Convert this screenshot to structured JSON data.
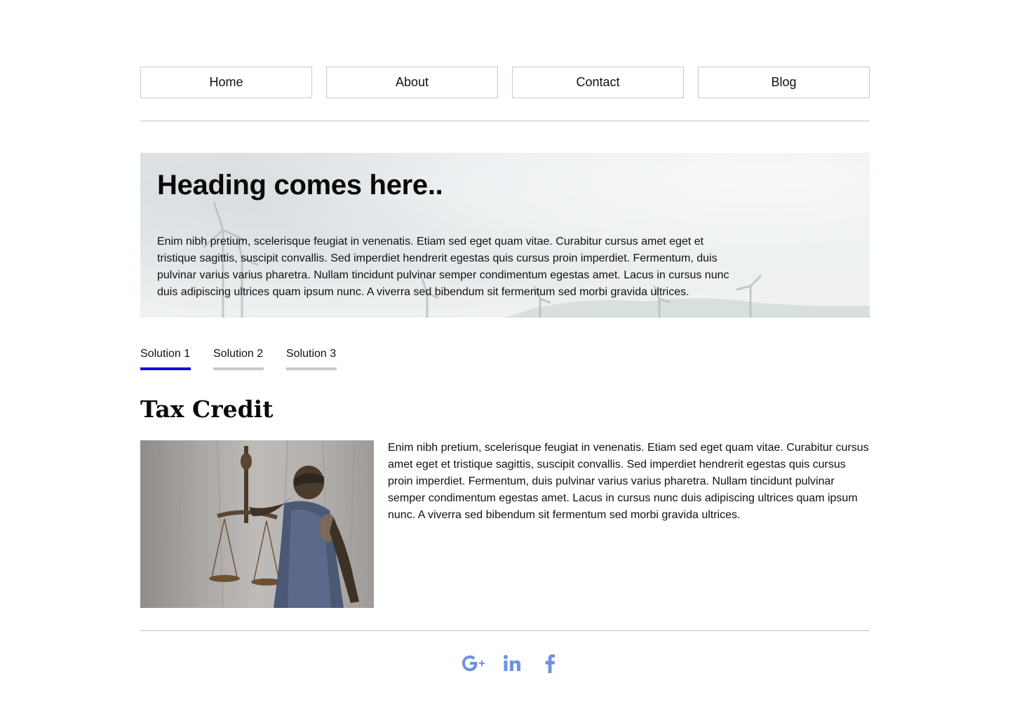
{
  "nav": {
    "items": [
      {
        "label": "Home"
      },
      {
        "label": "About"
      },
      {
        "label": "Contact"
      },
      {
        "label": "Blog"
      }
    ]
  },
  "hero": {
    "title": "Heading comes here..",
    "body": "Enim nibh pretium, scelerisque feugiat in venenatis. Etiam sed eget quam vitae. Curabitur cursus amet eget et tristique sagittis, suscipit convallis. Sed imperdiet hendrerit egestas quis cursus proin imperdiet. Fermentum, duis pulvinar varius varius pharetra. Nullam tincidunt pulvinar semper condimentum egestas amet. Lacus in cursus nunc duis adipiscing ultrices quam ipsum nunc. A viverra sed bibendum sit fermentum sed morbi gravida ultrices."
  },
  "tabs": [
    {
      "label": "Solution 1",
      "active": true
    },
    {
      "label": "Solution 2",
      "active": false
    },
    {
      "label": "Solution 3",
      "active": false
    }
  ],
  "content": {
    "title": "Tax Credit",
    "body": "Enim nibh pretium, scelerisque feugiat in venenatis. Etiam sed eget quam vitae. Curabitur cursus amet eget et tristique sagittis, suscipit convallis. Sed imperdiet hendrerit egestas quis cursus proin imperdiet. Fermentum, duis pulvinar varius varius pharetra. Nullam tincidunt pulvinar semper condimentum egestas amet. Lacus in cursus nunc duis adipiscing ultrices quam ipsum nunc. A viverra sed bibendum sit fermentum sed morbi gravida ultrices."
  },
  "footer": {
    "social": [
      {
        "icon": "google-plus-icon"
      },
      {
        "icon": "linkedin-icon"
      },
      {
        "icon": "facebook-icon"
      }
    ]
  },
  "colors": {
    "tab_active": "#1410d6",
    "tab_inactive": "#c8c8c8",
    "social_icon": "#6f92e0"
  }
}
